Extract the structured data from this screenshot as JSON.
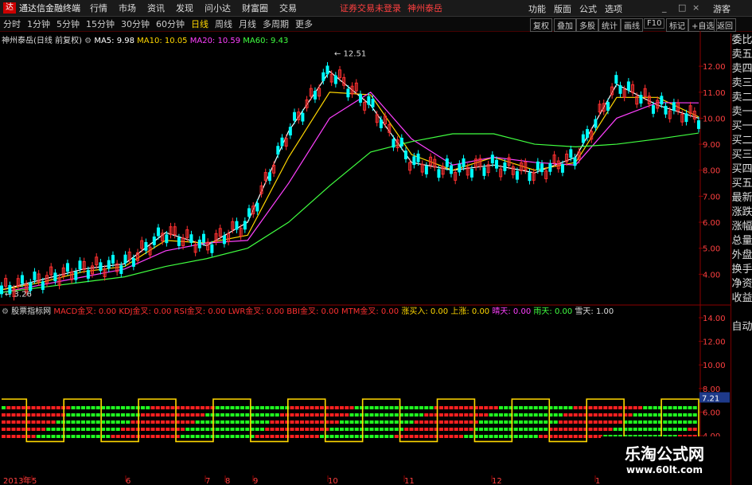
{
  "menubar": {
    "app_title": "通达信金融终端",
    "items": [
      "行情",
      "市场",
      "资讯",
      "发现",
      "问小达",
      "财富圈",
      "交易"
    ],
    "warn": "证券交易未登录",
    "stock": "神州泰岳",
    "right": [
      "功能",
      "版面",
      "公式",
      "选项"
    ],
    "guest": "游客"
  },
  "toolbar": {
    "periods": [
      "分时",
      "1分钟",
      "5分钟",
      "15分钟",
      "30分钟",
      "60分钟",
      "日线",
      "周线",
      "月线",
      "多周期",
      "更多"
    ],
    "active_index": 6,
    "right": [
      "复权",
      "叠加",
      "多股",
      "统计",
      "画线",
      "F10",
      "标记",
      "+自选",
      "返回"
    ]
  },
  "main_legend": {
    "name": "神州泰岳(日线 前复权)",
    "items": [
      {
        "label": "MA5: 9.98",
        "color": "#ffffff"
      },
      {
        "label": "MA10: 10.05",
        "color": "#ffd700"
      },
      {
        "label": "MA20: 10.59",
        "color": "#ff40ff"
      },
      {
        "label": "MA60: 9.43",
        "color": "#40ff40"
      }
    ]
  },
  "sub_legend": {
    "name": "股票指标网",
    "items": [
      {
        "label": "MACD金叉: 0.00",
        "color": "#ff3030"
      },
      {
        "label": "KDJ金叉: 0.00",
        "color": "#ff3030"
      },
      {
        "label": "RSI金叉: 0.00",
        "color": "#ff3030"
      },
      {
        "label": "LWR金叉: 0.00",
        "color": "#ff3030"
      },
      {
        "label": "BBI金叉: 0.00",
        "color": "#ff3030"
      },
      {
        "label": "MTM金叉: 0.00",
        "color": "#ff3030"
      },
      {
        "label": "涨买入: 0.00",
        "color": "#ffd700"
      },
      {
        "label": "上涨: 0.00",
        "color": "#ffd700"
      },
      {
        "label": "晴天: 0.00",
        "color": "#ff40ff"
      },
      {
        "label": "雨天: 0.00",
        "color": "#40ff40"
      },
      {
        "label": "雪天: 1.00",
        "color": "#dddddd"
      }
    ]
  },
  "side_panel": [
    "委比",
    "卖五",
    "卖四",
    "卖三",
    "卖二",
    "卖一",
    "买一",
    "买二",
    "买三",
    "买四",
    "买五",
    "最新",
    "涨跌",
    "涨幅",
    "总量",
    "外盘",
    "换手",
    "净资",
    "收益",
    "",
    "自动"
  ],
  "chart_data": {
    "type": "line",
    "title": "",
    "x_labels": [
      "2013年",
      "5",
      "6",
      "7",
      "8",
      "9",
      "10",
      "11",
      "12",
      "1"
    ],
    "price_axis": {
      "ticks": [
        "12.00",
        "11.00",
        "10.00",
        "9.00",
        "8.00",
        "7.00",
        "6.00",
        "5.00",
        "4.00"
      ],
      "ylim": [
        3.0,
        12.8
      ]
    },
    "annotations": {
      "high": "12.51",
      "low": "3.26"
    },
    "series": [
      {
        "name": "MA5",
        "color": "#ffffff",
        "values": [
          3.4,
          3.8,
          4.2,
          4.4,
          5.6,
          5.1,
          6.0,
          9.5,
          11.8,
          10.5,
          8.3,
          8.0,
          8.2,
          7.9,
          8.5,
          11.3,
          10.5,
          10.0
        ]
      },
      {
        "name": "MA10",
        "color": "#ffd700",
        "values": [
          3.4,
          3.7,
          4.1,
          4.3,
          5.3,
          5.2,
          5.5,
          8.5,
          11.0,
          10.9,
          8.6,
          8.0,
          8.5,
          8.0,
          8.3,
          10.8,
          10.8,
          10.05
        ]
      },
      {
        "name": "MA20",
        "color": "#ff40ff",
        "values": [
          3.3,
          3.6,
          3.9,
          4.2,
          4.9,
          5.2,
          5.3,
          7.5,
          10.0,
          11.0,
          9.2,
          8.2,
          8.5,
          8.3,
          8.2,
          10.0,
          10.6,
          10.59
        ]
      },
      {
        "name": "MA60",
        "color": "#40ff40",
        "values": [
          3.3,
          3.5,
          3.7,
          3.9,
          4.3,
          4.6,
          5.0,
          6.0,
          7.4,
          8.7,
          9.1,
          9.4,
          9.4,
          9.0,
          8.9,
          9.0,
          9.2,
          9.43
        ]
      }
    ],
    "sub_axis": {
      "ticks": [
        "14.00",
        "12.00",
        "10.00",
        "8.00",
        "6.00",
        "4.00"
      ],
      "current": "7.21"
    }
  },
  "watermark": {
    "name": "乐淘公式网",
    "url": "www.60lt.com"
  }
}
